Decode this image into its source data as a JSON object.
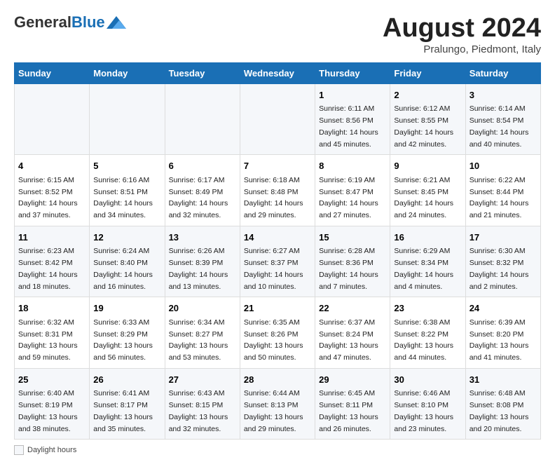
{
  "header": {
    "logo_general": "General",
    "logo_blue": "Blue",
    "month_title": "August 2024",
    "subtitle": "Pralungo, Piedmont, Italy"
  },
  "days_of_week": [
    "Sunday",
    "Monday",
    "Tuesday",
    "Wednesday",
    "Thursday",
    "Friday",
    "Saturday"
  ],
  "weeks": [
    [
      {
        "day": "",
        "text": ""
      },
      {
        "day": "",
        "text": ""
      },
      {
        "day": "",
        "text": ""
      },
      {
        "day": "",
        "text": ""
      },
      {
        "day": "1",
        "sunrise": "6:11 AM",
        "sunset": "8:56 PM",
        "daylight": "14 hours and 45 minutes."
      },
      {
        "day": "2",
        "sunrise": "6:12 AM",
        "sunset": "8:55 PM",
        "daylight": "14 hours and 42 minutes."
      },
      {
        "day": "3",
        "sunrise": "6:14 AM",
        "sunset": "8:54 PM",
        "daylight": "14 hours and 40 minutes."
      }
    ],
    [
      {
        "day": "4",
        "sunrise": "6:15 AM",
        "sunset": "8:52 PM",
        "daylight": "14 hours and 37 minutes."
      },
      {
        "day": "5",
        "sunrise": "6:16 AM",
        "sunset": "8:51 PM",
        "daylight": "14 hours and 34 minutes."
      },
      {
        "day": "6",
        "sunrise": "6:17 AM",
        "sunset": "8:49 PM",
        "daylight": "14 hours and 32 minutes."
      },
      {
        "day": "7",
        "sunrise": "6:18 AM",
        "sunset": "8:48 PM",
        "daylight": "14 hours and 29 minutes."
      },
      {
        "day": "8",
        "sunrise": "6:19 AM",
        "sunset": "8:47 PM",
        "daylight": "14 hours and 27 minutes."
      },
      {
        "day": "9",
        "sunrise": "6:21 AM",
        "sunset": "8:45 PM",
        "daylight": "14 hours and 24 minutes."
      },
      {
        "day": "10",
        "sunrise": "6:22 AM",
        "sunset": "8:44 PM",
        "daylight": "14 hours and 21 minutes."
      }
    ],
    [
      {
        "day": "11",
        "sunrise": "6:23 AM",
        "sunset": "8:42 PM",
        "daylight": "14 hours and 18 minutes."
      },
      {
        "day": "12",
        "sunrise": "6:24 AM",
        "sunset": "8:40 PM",
        "daylight": "14 hours and 16 minutes."
      },
      {
        "day": "13",
        "sunrise": "6:26 AM",
        "sunset": "8:39 PM",
        "daylight": "14 hours and 13 minutes."
      },
      {
        "day": "14",
        "sunrise": "6:27 AM",
        "sunset": "8:37 PM",
        "daylight": "14 hours and 10 minutes."
      },
      {
        "day": "15",
        "sunrise": "6:28 AM",
        "sunset": "8:36 PM",
        "daylight": "14 hours and 7 minutes."
      },
      {
        "day": "16",
        "sunrise": "6:29 AM",
        "sunset": "8:34 PM",
        "daylight": "14 hours and 4 minutes."
      },
      {
        "day": "17",
        "sunrise": "6:30 AM",
        "sunset": "8:32 PM",
        "daylight": "14 hours and 2 minutes."
      }
    ],
    [
      {
        "day": "18",
        "sunrise": "6:32 AM",
        "sunset": "8:31 PM",
        "daylight": "13 hours and 59 minutes."
      },
      {
        "day": "19",
        "sunrise": "6:33 AM",
        "sunset": "8:29 PM",
        "daylight": "13 hours and 56 minutes."
      },
      {
        "day": "20",
        "sunrise": "6:34 AM",
        "sunset": "8:27 PM",
        "daylight": "13 hours and 53 minutes."
      },
      {
        "day": "21",
        "sunrise": "6:35 AM",
        "sunset": "8:26 PM",
        "daylight": "13 hours and 50 minutes."
      },
      {
        "day": "22",
        "sunrise": "6:37 AM",
        "sunset": "8:24 PM",
        "daylight": "13 hours and 47 minutes."
      },
      {
        "day": "23",
        "sunrise": "6:38 AM",
        "sunset": "8:22 PM",
        "daylight": "13 hours and 44 minutes."
      },
      {
        "day": "24",
        "sunrise": "6:39 AM",
        "sunset": "8:20 PM",
        "daylight": "13 hours and 41 minutes."
      }
    ],
    [
      {
        "day": "25",
        "sunrise": "6:40 AM",
        "sunset": "8:19 PM",
        "daylight": "13 hours and 38 minutes."
      },
      {
        "day": "26",
        "sunrise": "6:41 AM",
        "sunset": "8:17 PM",
        "daylight": "13 hours and 35 minutes."
      },
      {
        "day": "27",
        "sunrise": "6:43 AM",
        "sunset": "8:15 PM",
        "daylight": "13 hours and 32 minutes."
      },
      {
        "day": "28",
        "sunrise": "6:44 AM",
        "sunset": "8:13 PM",
        "daylight": "13 hours and 29 minutes."
      },
      {
        "day": "29",
        "sunrise": "6:45 AM",
        "sunset": "8:11 PM",
        "daylight": "13 hours and 26 minutes."
      },
      {
        "day": "30",
        "sunrise": "6:46 AM",
        "sunset": "8:10 PM",
        "daylight": "13 hours and 23 minutes."
      },
      {
        "day": "31",
        "sunrise": "6:48 AM",
        "sunset": "8:08 PM",
        "daylight": "13 hours and 20 minutes."
      }
    ]
  ],
  "legend": {
    "daylight_label": "Daylight hours"
  }
}
